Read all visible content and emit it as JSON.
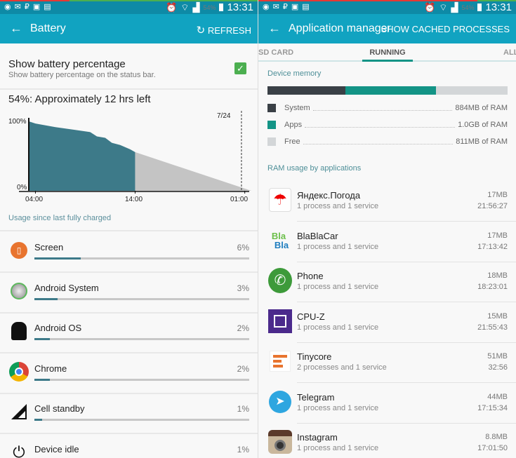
{
  "status_bar": {
    "battery": "54%",
    "time": "13:31",
    "left_icons": [
      "notification-icon",
      "mail-icon",
      "ruble-icon",
      "gallery-icon",
      "clipboard-icon"
    ],
    "right_icons": [
      "alarm-icon",
      "wifi-icon",
      "signal-icon",
      "battery-icon"
    ]
  },
  "battery": {
    "toolbar": {
      "title": "Battery",
      "action": "REFRESH"
    },
    "show_pct": {
      "title": "Show battery percentage",
      "subtitle": "Show battery percentage on the status bar.",
      "checked": true
    },
    "summary": "54%: Approximately 12 hrs left",
    "usage_label": "Usage since last fully charged",
    "items": [
      {
        "label": "Screen",
        "percent": "6%",
        "value": 6,
        "icon": "screen-icon"
      },
      {
        "label": "Android System",
        "percent": "3%",
        "value": 3,
        "icon": "android-system-icon"
      },
      {
        "label": "Android OS",
        "percent": "2%",
        "value": 2,
        "icon": "android-robot-icon"
      },
      {
        "label": "Chrome",
        "percent": "2%",
        "value": 2,
        "icon": "chrome-icon"
      },
      {
        "label": "Cell standby",
        "percent": "1%",
        "value": 1,
        "icon": "cell-signal-icon"
      },
      {
        "label": "Device idle",
        "percent": "1%",
        "value": 1,
        "icon": "power-icon"
      }
    ]
  },
  "chart_data": {
    "type": "area",
    "y_tick_labels": [
      "100%",
      "0%"
    ],
    "ylim": [
      0,
      100
    ],
    "x_tick_labels": [
      "04:00",
      "14:00",
      "01:00"
    ],
    "marker_label": "7/24",
    "marker_time": "24:40",
    "colors": {
      "actual": "#3d7a89",
      "predicted": "#c4c4c4"
    },
    "series": [
      {
        "kind": "actual",
        "points": [
          [
            "03:20",
            97
          ],
          [
            "04:00",
            94
          ],
          [
            "06:00",
            89
          ],
          [
            "08:00",
            85
          ],
          [
            "09:30",
            82
          ],
          [
            "10:10",
            76
          ],
          [
            "11:00",
            74
          ],
          [
            "11:40",
            67
          ],
          [
            "12:30",
            64
          ],
          [
            "13:30",
            58
          ],
          [
            "14:00",
            54
          ]
        ]
      },
      {
        "kind": "predicted",
        "points": [
          [
            "14:00",
            54
          ],
          [
            "25:40",
            0
          ]
        ]
      }
    ]
  },
  "appmgr": {
    "toolbar": {
      "title": "Application manager",
      "action": "SHOW CACHED PROCESSES"
    },
    "tabs": [
      {
        "label": "SD CARD"
      },
      {
        "label": "RUNNING",
        "active": true
      },
      {
        "label": "ALL"
      }
    ],
    "memory_title": "Device memory",
    "memory": [
      {
        "label": "System",
        "value": "884MB of RAM",
        "mb": 884,
        "color": "#3a4046"
      },
      {
        "label": "Apps",
        "value": "1.0GB of RAM",
        "mb": 1024,
        "color": "#139486"
      },
      {
        "label": "Free",
        "value": "811MB of RAM",
        "mb": 811,
        "color": "#d3d6d8"
      }
    ],
    "ram_title": "RAM usage by applications",
    "apps": [
      {
        "name": "Яндекс.Погода",
        "sub": "1 process and 1 service",
        "size": "17MB",
        "time": "21:56:27",
        "icon": "umbrella-icon"
      },
      {
        "name": "BlaBlaCar",
        "sub": "1 process and 1 service",
        "size": "17MB",
        "time": "17:13:42",
        "icon": "blablacar-icon",
        "logo_text": "Bla Bla"
      },
      {
        "name": "Phone",
        "sub": "1 process and 1 service",
        "size": "18MB",
        "time": "18:23:01",
        "icon": "phone-icon"
      },
      {
        "name": "CPU-Z",
        "sub": "1 process and 1 service",
        "size": "15MB",
        "time": "21:55:43",
        "icon": "cpu-chip-icon"
      },
      {
        "name": "Tinycore",
        "sub": "2 processes and 1 service",
        "size": "51MB",
        "time": "32:56",
        "icon": "tinycore-icon"
      },
      {
        "name": "Telegram",
        "sub": "1 process and 1 service",
        "size": "44MB",
        "time": "17:15:34",
        "icon": "telegram-icon"
      },
      {
        "name": "Instagram",
        "sub": "1 process and 1 service",
        "size": "8.8MB",
        "time": "17:01:50",
        "icon": "instagram-icon"
      }
    ]
  }
}
